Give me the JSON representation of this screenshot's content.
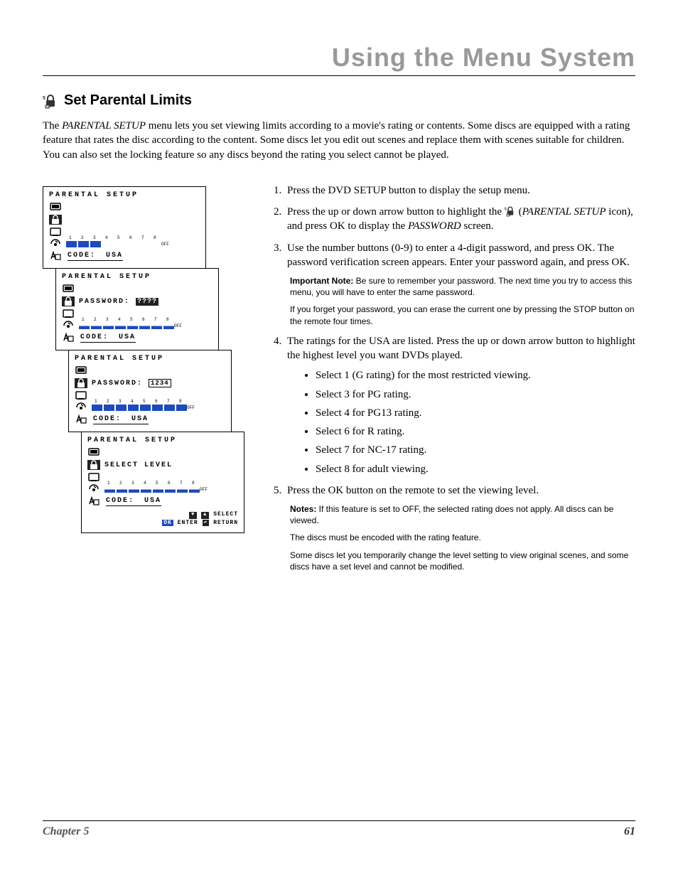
{
  "header": {
    "title": "Using the Menu System"
  },
  "section": {
    "title": "Set Parental Limits",
    "intro_part1": "The ",
    "intro_menu_name": "PARENTAL SETUP",
    "intro_part2": " menu lets you set viewing limits according to a movie's rating or contents. Some discs are equipped with a rating feature that rates the disc according to the content. Some discs let you edit out scenes and replace them with scenes suitable for children. You can also set the locking feature so any discs beyond the rating you select cannot be played."
  },
  "screens": {
    "common": {
      "title": "PARENTAL SETUP",
      "code_label": "CODE:",
      "code_value": "USA",
      "rating_numbers": [
        "1",
        "2",
        "3",
        "4",
        "5",
        "6",
        "7",
        "8"
      ],
      "rating_off": "OFF"
    },
    "s1": {
      "fill_segments": 3
    },
    "s2": {
      "password_label": "PASSWORD:",
      "password_value": "????",
      "fill_segments": 8,
      "half_segments": true
    },
    "s3": {
      "password_label": "PASSWORD:",
      "password_value": "1234",
      "fill_segments": 8
    },
    "s4": {
      "select_label": "SELECT LEVEL",
      "fill_segments": 8,
      "half_segments": true,
      "hints": {
        "select": "SELECT",
        "enter": "ENTER",
        "ok": "OK",
        "return": "RETURN"
      }
    }
  },
  "steps": {
    "s1": "Press the DVD SETUP button to display the setup menu.",
    "s2a": "Press the up or down arrow button to highlight the ",
    "s2b_icon_label": "PARENTAL SETUP",
    "s2c": " icon), and press OK to display the ",
    "s2d_password": "PASSWORD",
    "s2e": " screen.",
    "s3": "Use the number buttons (0-9) to enter a 4-digit password, and press OK. The password verification screen appears. Enter your password again, and press OK.",
    "note1_label": "Important Note:",
    "note1_body": " Be sure to remember your password. The next time you try to access this menu, you will have to enter the same password.",
    "note1_extra": "If you forget your password, you can erase the current one by pressing the STOP button on the remote four times.",
    "s4": "The ratings for the USA are listed. Press the up or down arrow button to highlight the highest level you want DVDs played.",
    "bullets": [
      "Select 1 (G rating) for the most restricted viewing.",
      "Select 3 for PG rating.",
      "Select 4 for PG13 rating.",
      "Select 6 for R rating.",
      "Select 7 for NC-17 rating.",
      "Select 8 for adult viewing."
    ],
    "s5": "Press the OK button on the remote to set the viewing level.",
    "note2_label": "Notes:",
    "note2_a": " If this feature is set to OFF, the selected rating does not apply. All discs can be viewed.",
    "note2_b": "The discs must be encoded with the rating feature.",
    "note2_c": "Some discs let you temporarily change the level setting to view original scenes, and some discs have a set level and cannot be modified."
  },
  "footer": {
    "chapter": "Chapter 5",
    "page": "61"
  }
}
